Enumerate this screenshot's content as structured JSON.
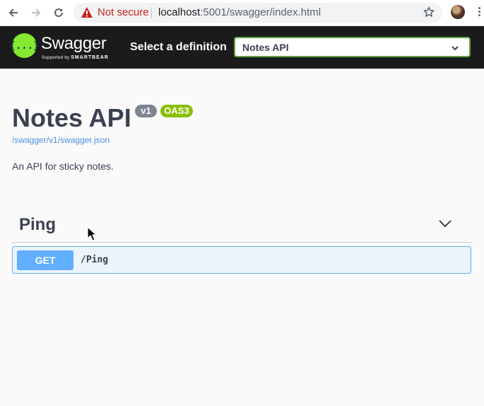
{
  "browser": {
    "security_label": "Not secure",
    "url_host": "localhost",
    "url_rest": ":5001/swagger/index.html"
  },
  "topbar": {
    "logo_symbol": "{...}",
    "logo_name": "Swagger",
    "logo_sub_prefix": "Supported by",
    "logo_sub_brand": "SMARTBEAR",
    "select_label": "Select a definition",
    "selected_definition": "Notes API"
  },
  "info": {
    "title": "Notes API",
    "version_badge": "v1",
    "oas_badge": "OAS3",
    "spec_link": "/swagger/v1/swagger.json",
    "description": "An API for sticky notes."
  },
  "tags": [
    {
      "name": "Ping",
      "operations": [
        {
          "method": "GET",
          "path": "/Ping"
        }
      ]
    }
  ],
  "colors": {
    "topbar_bg": "#1b1b1b",
    "logo_green": "#85ea2d",
    "select_border": "#62a03f",
    "version_badge": "#7d8492",
    "oas_badge": "#89bf04",
    "get_method": "#61affe",
    "get_row_bg": "#ebf3fb",
    "link": "#4990e2",
    "not_secure": "#c5221f"
  }
}
